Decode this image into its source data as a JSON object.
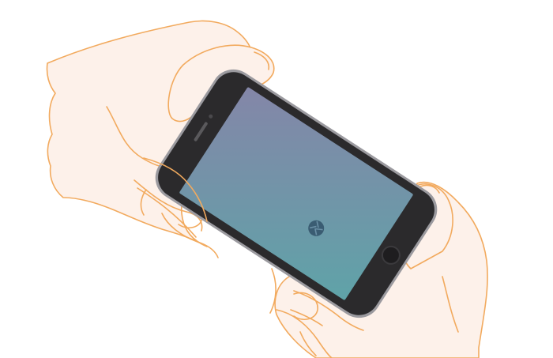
{
  "scene": {
    "subject": "phone-held-in-two-hands",
    "orientation": "landscape-tilted"
  },
  "phone": {
    "body_color": "#2b2a2c",
    "frame_color": "#9b9a9f",
    "screen_gradient_start": "#8486a8",
    "screen_gradient_end": "#5fa3a8",
    "home_button_color": "#1e1d1f",
    "icon": "shutter-icon",
    "icon_color": "#3a5c72"
  },
  "hands": {
    "skin_color": "#fdf1ea",
    "outline_color": "#f2aa5e"
  }
}
